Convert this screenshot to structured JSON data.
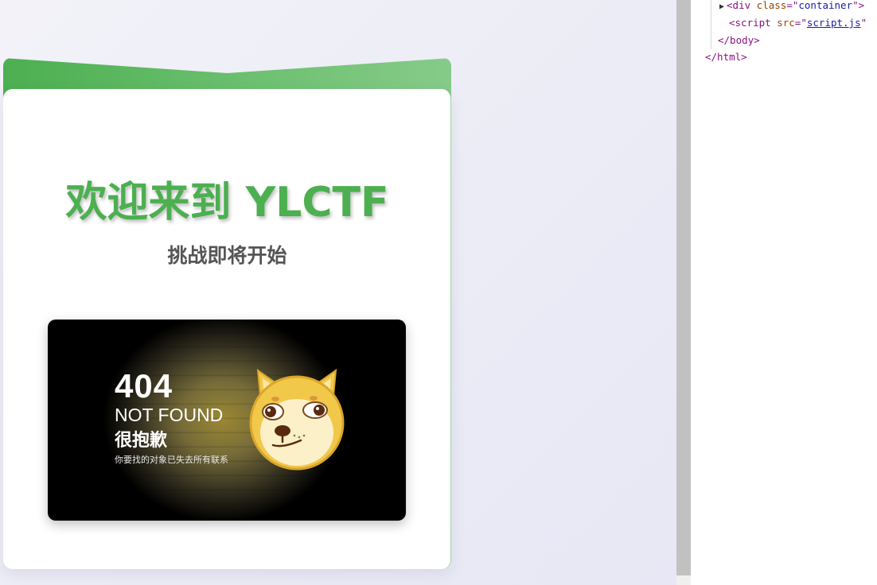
{
  "page": {
    "title": "欢迎来到 YLCTF",
    "subtitle": "挑战即将开始"
  },
  "image_404": {
    "code": "404",
    "not_found": "NOT FOUND",
    "sorry": "很抱歉",
    "description": "你要找的对象已失去所有联系"
  },
  "devtools": {
    "line1": {
      "tag_open": "<div ",
      "attr": "class",
      "eq": "=\"",
      "value": "container",
      "close": "\">"
    },
    "line2": {
      "tag_open": "<script ",
      "attr": "src",
      "eq": "=\"",
      "value": "script.js",
      "close": "\""
    },
    "line3": "</body>",
    "line4": "</html>"
  },
  "colors": {
    "accent": "#4caf50",
    "header_gradient_end": "#86cb89",
    "subtitle": "#555555"
  }
}
